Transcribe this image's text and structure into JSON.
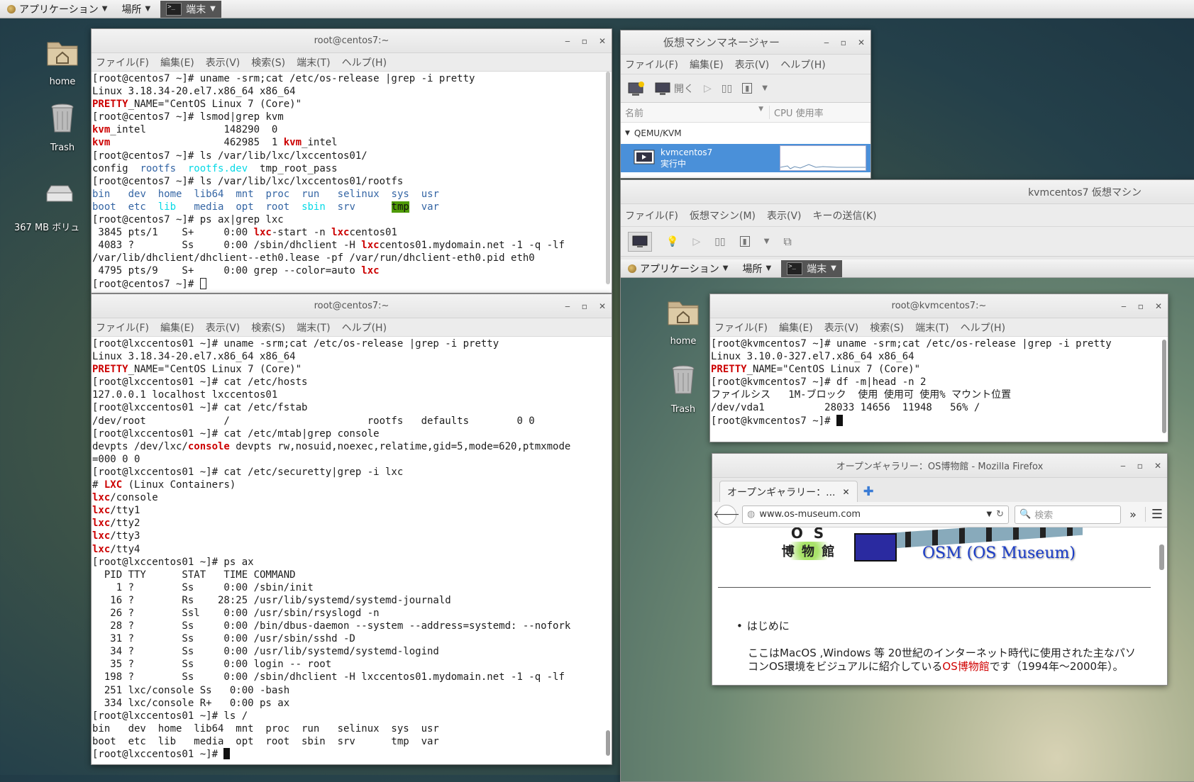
{
  "panel": {
    "apps": "アプリケーション",
    "places": "場所",
    "task": "端末"
  },
  "desktop": {
    "home": "home",
    "trash": "Trash",
    "volume": "367 MB ボリュ"
  },
  "term1": {
    "title": "root@centos7:~",
    "menu": [
      "ファイル(F)",
      "編集(E)",
      "表示(V)",
      "検索(S)",
      "端末(T)",
      "ヘルプ(H)"
    ]
  },
  "term2": {
    "title": "root@centos7:~",
    "menu": [
      "ファイル(F)",
      "編集(E)",
      "表示(V)",
      "検索(S)",
      "端末(T)",
      "ヘルプ(H)"
    ]
  },
  "vmm": {
    "title": "仮想マシンマネージャー",
    "menu": [
      "ファイル(F)",
      "編集(E)",
      "表示(V)",
      "ヘルプ(H)"
    ],
    "open": "開く",
    "col_name": "名前",
    "col_cpu": "CPU 使用率",
    "group": "QEMU/KVM",
    "vm_name": "kvmcentos7",
    "vm_state": "実行中"
  },
  "vmwin": {
    "title": "kvmcentos7 仮想マシン",
    "menu": [
      "ファイル(F)",
      "仮想マシン(M)",
      "表示(V)",
      "キーの送信(K)"
    ]
  },
  "guest": {
    "panel": {
      "apps": "アプリケーション",
      "places": "場所",
      "task": "端末"
    },
    "home": "home",
    "trash": "Trash",
    "term": {
      "title": "root@kvmcentos7:~",
      "menu": [
        "ファイル(F)",
        "編集(E)",
        "表示(V)",
        "検索(S)",
        "端末(T)",
        "ヘルプ(H)"
      ]
    },
    "ff": {
      "title": "オープンギャラリー：OS博物館 - Mozilla Firefox",
      "tab": "オープンギャラリー：...",
      "url": "www.os-museum.com",
      "search": "検索",
      "logo_os": "O S",
      "logo_kanji": "博 物 館",
      "banner": "OSM (OS Museum)",
      "bullet": "はじめに",
      "para1": "ここはMacOS ,Windows 等 20世紀のインターネット時代に使用された主なパソ",
      "para2a": "コンOS環境をビジュアルに紹介している",
      "para2link": "OS博物館",
      "para2b": "です（1994年～2000年）。"
    }
  }
}
